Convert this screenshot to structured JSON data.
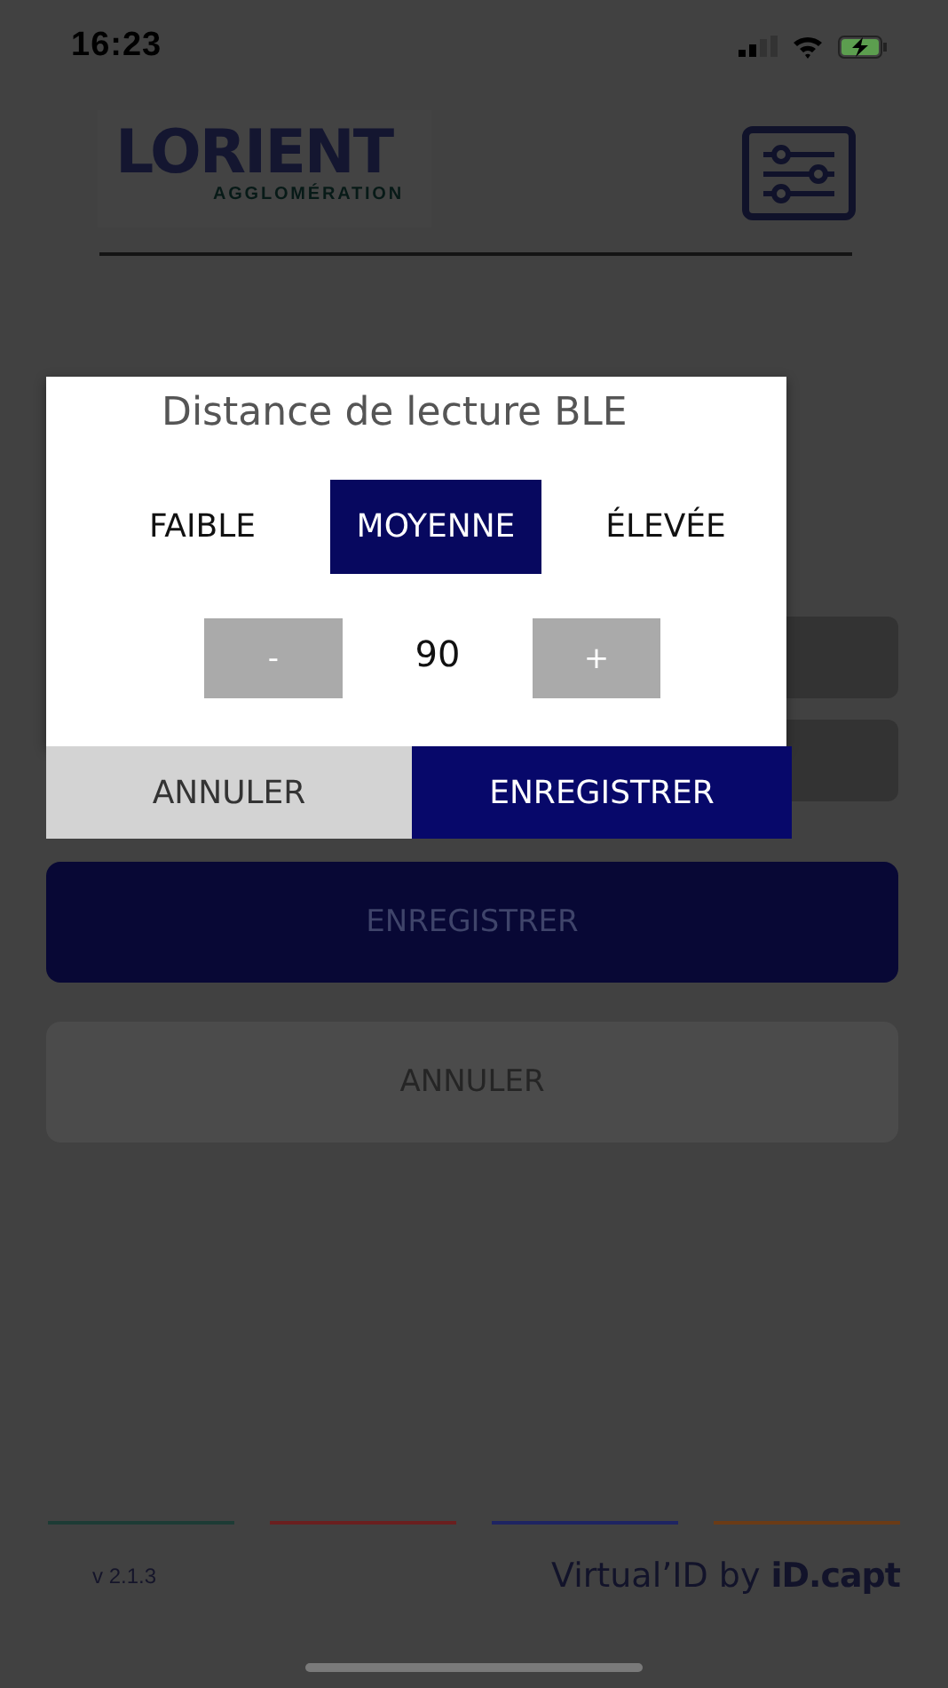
{
  "status_bar": {
    "time": "16:23"
  },
  "header": {
    "logo_name": "LORIENT",
    "logo_subtitle": "AGGLOMÉRATION"
  },
  "form": {
    "buttons": [
      {
        "label": "ENREGISTRER",
        "kind": "primary"
      },
      {
        "label": "ANNULER",
        "kind": "secondary"
      }
    ]
  },
  "dialog": {
    "title": "Distance de lecture BLE",
    "options": [
      {
        "label": "FAIBLE",
        "selected": false
      },
      {
        "label": "MOYENNE",
        "selected": true
      },
      {
        "label": "ÉLEVÉE",
        "selected": false
      }
    ],
    "stepper": {
      "minus": "-",
      "value": "90",
      "plus": "+"
    },
    "buttons": [
      {
        "label": "ANNULER",
        "kind": "secondary"
      },
      {
        "label": "ENREGISTRER",
        "kind": "primary"
      }
    ]
  },
  "footer": {
    "stripes": [
      {
        "color": "#1d3b35"
      },
      {
        "color": "#6a1f1f"
      },
      {
        "color": "#1e2462"
      },
      {
        "color": "#6b3b16"
      }
    ],
    "version": "v 2.1.3",
    "credit": "Virtual’ID by",
    "brand": "iD.capt"
  }
}
